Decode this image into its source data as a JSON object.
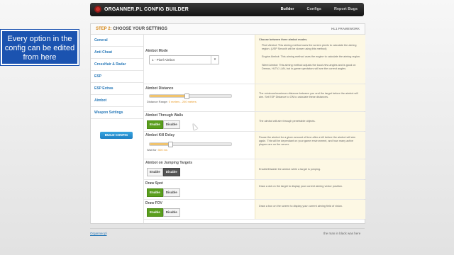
{
  "header": {
    "logo_text": "ORGANNER.PL CONFIG BUILDER",
    "nav": [
      "Builder",
      "Configs",
      "Report Bugs"
    ]
  },
  "step": {
    "title_num": "STEP 2:",
    "title_text": "CHOOSE YOUR SETTINGS",
    "framework": "HL1 FRAMEWORK"
  },
  "sidebar": {
    "items": [
      "General",
      "Anti Cheat",
      "CrossHair & Radar",
      "ESP",
      "ESP Extras",
      "Aimbot",
      "Weapon Settings"
    ],
    "build_label": "BUILD CONFIG"
  },
  "rows": {
    "aimbot_mode": {
      "label": "Aimbot Mode",
      "select_value": "1 - Pixel Aimbot",
      "desc_intro": "Choose between three aimbot modes.",
      "desc_items": [
        "Pixel Aimbot: This aiming method uses the screen pixels to calculate the aiming region. (USP Smooth will be slower using this method)",
        "Engine Aimbot: This aiming method uses the engine to calculate the aiming region.",
        "Silent Aimbot: This aiming method adjusts the local view angles and is good on Demos, HLTV, LAN, but in-game spectators will see the correct angles."
      ]
    },
    "aimbot_distance": {
      "label": "Aimbot Distance",
      "range_label": "Distance Range:",
      "range_value": "0 meters - 200 meters",
      "fill_fraction": 0.45,
      "desc": "The minimum/maximum distance between you and the target before the aimbot will aim. Set ESP Distance to ON to calculate these distances."
    },
    "through_walls": {
      "label": "Aimbot Through Walls",
      "enable": "Enable",
      "disable": "Disable",
      "desc": "The aimbot will aim through penetrable objects."
    },
    "kill_delay": {
      "label": "Aimbot Kill Delay",
      "range_label": "Wait for:",
      "range_value": "500 ms",
      "fill_fraction": 0.25,
      "desc": "Pause the aimbot for a given amount of time after a kill before the aimbot will aim again. This will be dependant on your game environment, and how many active players are on the server."
    },
    "jumping_targets": {
      "label": "Aimbot on Jumping Targets",
      "enable": "Enable",
      "disable": "Disable",
      "desc": "Enable/Disable the aimbot while a target is jumping."
    },
    "draw_spot": {
      "label": "Draw Spot",
      "enable": "Enable",
      "disable": "Disable",
      "desc": "Draw a dot on the target to display your current aiming vector position."
    },
    "draw_fov": {
      "label": "Draw FOV",
      "enable": "Enable",
      "disable": "Disable",
      "desc": "Draw a box on the screen to display your current aiming field of vision."
    }
  },
  "footer": {
    "left": "Organner.pl",
    "right": "the man in black was here"
  },
  "overlay": {
    "callout": "Every option in the config can be edited from here"
  },
  "colors": {
    "enabled": "#5a9e1e",
    "disabled_active": "#555555",
    "accent": "#2a7ab9",
    "slider": "#f0c36d"
  }
}
